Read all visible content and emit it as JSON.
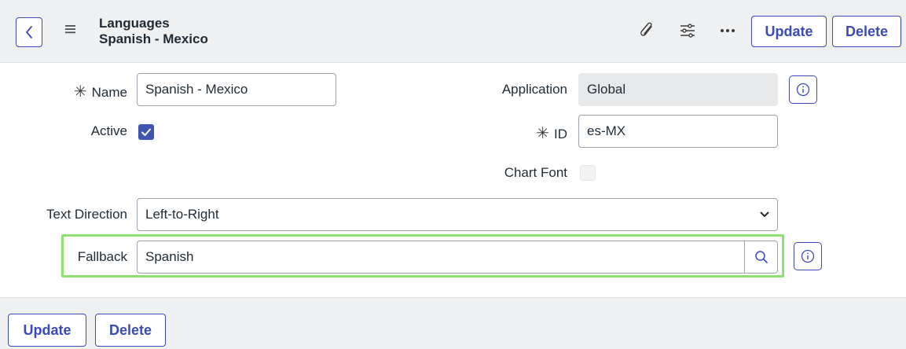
{
  "header": {
    "title": "Languages",
    "subtitle": "Spanish - Mexico",
    "update_label": "Update",
    "delete_label": "Delete"
  },
  "form": {
    "name": {
      "label": "Name",
      "value": "Spanish - Mexico",
      "required": true
    },
    "active": {
      "label": "Active",
      "checked": true
    },
    "application": {
      "label": "Application",
      "value": "Global"
    },
    "id": {
      "label": "ID",
      "value": "es-MX",
      "required": true
    },
    "chart_font": {
      "label": "Chart Font",
      "checked": false
    },
    "text_direction": {
      "label": "Text Direction",
      "value": "Left-to-Right"
    },
    "fallback": {
      "label": "Fallback",
      "value": "Spanish"
    }
  },
  "footer": {
    "update_label": "Update",
    "delete_label": "Delete"
  },
  "colors": {
    "accent": "#3c49b8",
    "highlight": "#8ee06f",
    "checkbox": "#4054b2"
  },
  "icons": {
    "back": "chevron-left-icon",
    "menu": "hamburger-menu-icon",
    "attachment": "paperclip-icon",
    "personalize": "sliders-icon",
    "more": "more-options-icon",
    "lookup": "search-icon",
    "info": "info-icon"
  }
}
